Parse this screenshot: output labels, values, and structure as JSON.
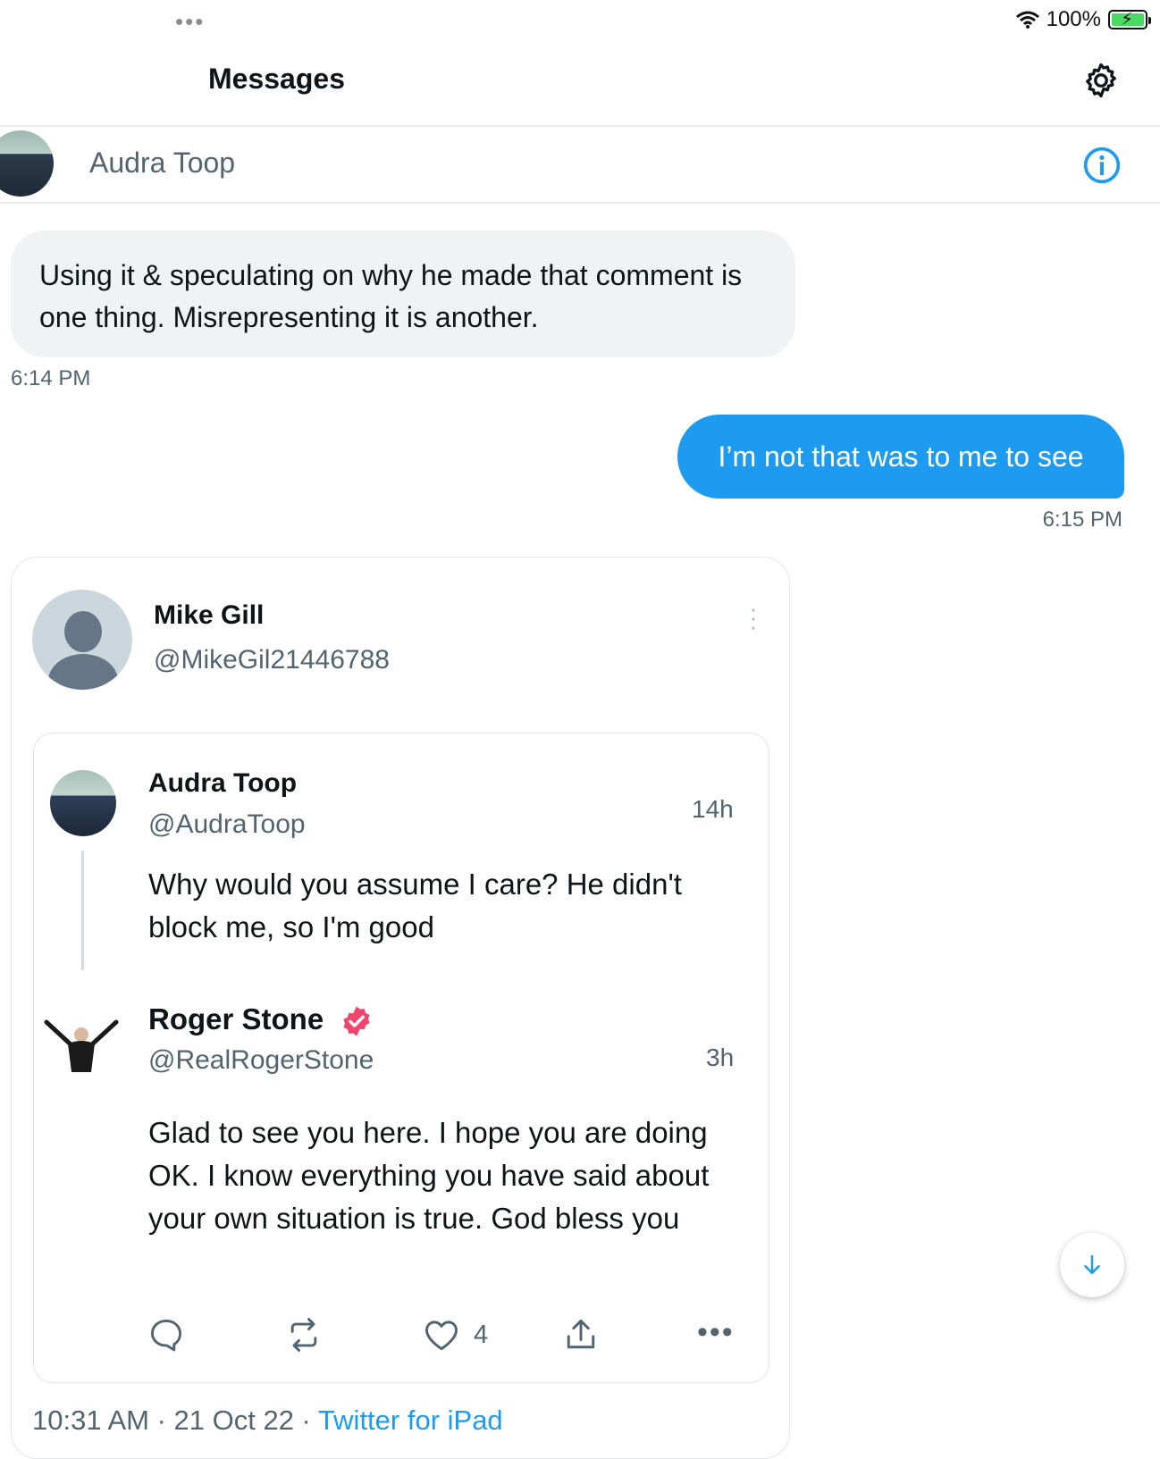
{
  "status_bar": {
    "dots": "•••",
    "battery": "100%"
  },
  "header": {
    "title": "Messages"
  },
  "conversation": {
    "name": "Audra Toop"
  },
  "messages": [
    {
      "text": "Using it & speculating on why he made that comment is one thing. Misrepresenting it is another.",
      "time": "6:14 PM"
    },
    {
      "text": "I’m not that was to me to see",
      "time": "6:15 PM"
    }
  ],
  "shared_tweet": {
    "author_name": "Mike Gill",
    "author_handle": "@MikeGil21446788",
    "quoted": [
      {
        "name": "Audra Toop",
        "handle": "@AudraToop",
        "time": "14h",
        "text": "Why would you assume I care? He didn't block me, so I'm good"
      },
      {
        "name": "Roger Stone",
        "handle": "@RealRogerStone",
        "time": "3h",
        "text": "Glad to see you here. I hope you are doing OK. I know everything you have said about your own situation is true. God bless you"
      }
    ],
    "like_count": "4",
    "more": "•••",
    "date": "10:31 AM · 21 Oct 22 · ",
    "source": "Twitter for iPad"
  },
  "icons": {
    "gear": "gear-icon",
    "info": "info-icon",
    "reply": "reply-icon",
    "retweet": "retweet-icon",
    "like": "heart-icon",
    "share": "share-icon",
    "scroll": "arrow-down-icon",
    "verified": "verified-badge-icon"
  },
  "colors": {
    "accent": "#1d9bf0",
    "bubble_incoming": "#eff3f4",
    "verified": "#f4436c"
  }
}
